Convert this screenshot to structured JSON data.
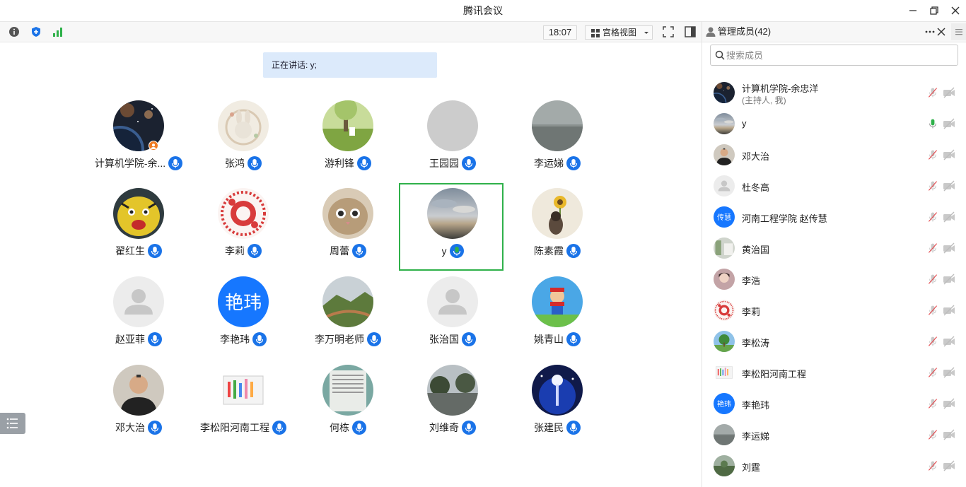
{
  "window": {
    "title": "腾讯会议"
  },
  "toolbar": {
    "time": "18:07",
    "view_mode": "宫格视图"
  },
  "main": {
    "speaking_label": "正在讲话: y;"
  },
  "colors": {
    "mic_blue": "#1a73e8",
    "mic_green": "#2fb14a",
    "active_border": "#2fb14a",
    "muted_red": "#e5484d"
  },
  "grid": [
    {
      "name": "计算机学院-余...",
      "avatar": "space",
      "host": true,
      "speaking": false
    },
    {
      "name": "张鸿",
      "avatar": "bunny",
      "host": false,
      "speaking": false
    },
    {
      "name": "游利锋",
      "avatar": "grass",
      "host": false,
      "speaking": false
    },
    {
      "name": "王园园",
      "avatar": "empty",
      "host": false,
      "speaking": false
    },
    {
      "name": "李运娣",
      "avatar": "sea",
      "host": false,
      "speaking": false
    },
    {
      "name": "翟红生",
      "avatar": "tiger",
      "host": false,
      "speaking": false
    },
    {
      "name": "李莉",
      "avatar": "papercut",
      "host": false,
      "speaking": false
    },
    {
      "name": "周蕾",
      "avatar": "cat",
      "host": false,
      "speaking": false
    },
    {
      "name": "y",
      "avatar": "sky",
      "host": false,
      "speaking": true
    },
    {
      "name": "陈素霞",
      "avatar": "sunflower",
      "host": false,
      "speaking": false
    },
    {
      "name": "赵亚菲",
      "avatar": "default",
      "host": false,
      "speaking": false
    },
    {
      "name": "李艳玮",
      "avatar": "text",
      "avatar_text": "艳玮",
      "host": false,
      "speaking": false
    },
    {
      "name": "李万明老师",
      "avatar": "mountain",
      "host": false,
      "speaking": false
    },
    {
      "name": "张治国",
      "avatar": "default",
      "host": false,
      "speaking": false
    },
    {
      "name": "姚青山",
      "avatar": "mario",
      "host": false,
      "speaking": false
    },
    {
      "name": "邓大治",
      "avatar": "man",
      "host": false,
      "speaking": false
    },
    {
      "name": "李松阳河南工程",
      "avatar": "drawing",
      "host": false,
      "speaking": false
    },
    {
      "name": "何栋",
      "avatar": "document",
      "host": false,
      "speaking": false
    },
    {
      "name": "刘维奇",
      "avatar": "lake",
      "host": false,
      "speaking": false
    },
    {
      "name": "张建民",
      "avatar": "lamp",
      "host": false,
      "speaking": false
    }
  ],
  "panel": {
    "title": "管理成员(42)",
    "search_placeholder": "搜索成员",
    "members": [
      {
        "name": "计算机学院-余忠洋",
        "sub": "(主持人, 我)",
        "avatar": "space",
        "mic": "muted"
      },
      {
        "name": "y",
        "sub": "",
        "avatar": "sky",
        "mic": "active"
      },
      {
        "name": "邓大治",
        "sub": "",
        "avatar": "man",
        "mic": "muted"
      },
      {
        "name": "杜冬高",
        "sub": "",
        "avatar": "default",
        "mic": "muted"
      },
      {
        "name": "河南工程学院 赵传慧",
        "sub": "",
        "avatar": "text",
        "avatar_text": "传慧",
        "mic": "muted"
      },
      {
        "name": "黄治国",
        "sub": "",
        "avatar": "room",
        "mic": "muted"
      },
      {
        "name": "李浩",
        "sub": "",
        "avatar": "girl",
        "mic": "muted"
      },
      {
        "name": "李莉",
        "sub": "",
        "avatar": "papercut",
        "mic": "muted"
      },
      {
        "name": "李松涛",
        "sub": "",
        "avatar": "tree",
        "mic": "muted"
      },
      {
        "name": "李松阳河南工程",
        "sub": "",
        "avatar": "drawing",
        "mic": "muted"
      },
      {
        "name": "李艳玮",
        "sub": "",
        "avatar": "text",
        "avatar_text": "艳玮",
        "mic": "muted"
      },
      {
        "name": "李运娣",
        "sub": "",
        "avatar": "sea",
        "mic": "muted"
      },
      {
        "name": "刘霆",
        "sub": "",
        "avatar": "field",
        "mic": "muted"
      }
    ]
  }
}
